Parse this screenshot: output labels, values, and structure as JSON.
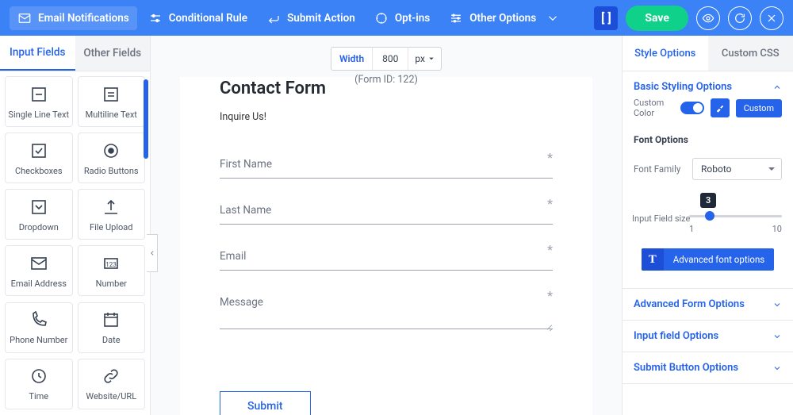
{
  "toolbar": {
    "items": [
      {
        "label": "Email Notifications",
        "icon": "mail"
      },
      {
        "label": "Conditional Rule",
        "icon": "sliders"
      },
      {
        "label": "Submit Action",
        "icon": "return"
      },
      {
        "label": "Opt-ins",
        "icon": "optin"
      },
      {
        "label": "Other Options",
        "icon": "settings",
        "chevron": true
      }
    ],
    "save_label": "Save"
  },
  "left_panel": {
    "tabs": {
      "input": "Input Fields",
      "other": "Other Fields"
    },
    "fields": [
      {
        "label": "Single Line Text",
        "icon": "text-line"
      },
      {
        "label": "Multiline Text",
        "icon": "text-multi"
      },
      {
        "label": "Checkboxes",
        "icon": "checkbox"
      },
      {
        "label": "Radio Buttons",
        "icon": "radio"
      },
      {
        "label": "Dropdown",
        "icon": "dropdown"
      },
      {
        "label": "File Upload",
        "icon": "upload"
      },
      {
        "label": "Email Address",
        "icon": "mail"
      },
      {
        "label": "Number",
        "icon": "number"
      },
      {
        "label": "Phone Number",
        "icon": "phone"
      },
      {
        "label": "Date",
        "icon": "date"
      },
      {
        "label": "Time",
        "icon": "time"
      },
      {
        "label": "Website/URL",
        "icon": "link"
      }
    ]
  },
  "canvas": {
    "width_label": "Width",
    "width_value": "800",
    "width_unit": "px",
    "form_id_text": "(Form ID: 122)",
    "form": {
      "title": "Contact Form",
      "subtitle": "Inquire Us!",
      "fields": [
        {
          "label": "First Name"
        },
        {
          "label": "Last Name"
        },
        {
          "label": "Email"
        },
        {
          "label": "Message",
          "multiline": true
        }
      ],
      "submit": "Submit"
    }
  },
  "right_panel": {
    "tabs": {
      "style": "Style Options",
      "css": "Custom CSS"
    },
    "sections": {
      "basic": "Basic Styling Options",
      "advanced_form": "Advanced Form Options",
      "input_field": "Input field Options",
      "submit_button": "Submit Button Options"
    },
    "custom_color": {
      "label": "Custom Color",
      "button": "Custom"
    },
    "font_options_title": "Font Options",
    "font_family": {
      "label": "Font Family",
      "value": "Roboto"
    },
    "input_size": {
      "label": "Input Field size",
      "value": "3",
      "min": "1",
      "max": "10"
    },
    "adv_font_btn": "Advanced font options"
  }
}
